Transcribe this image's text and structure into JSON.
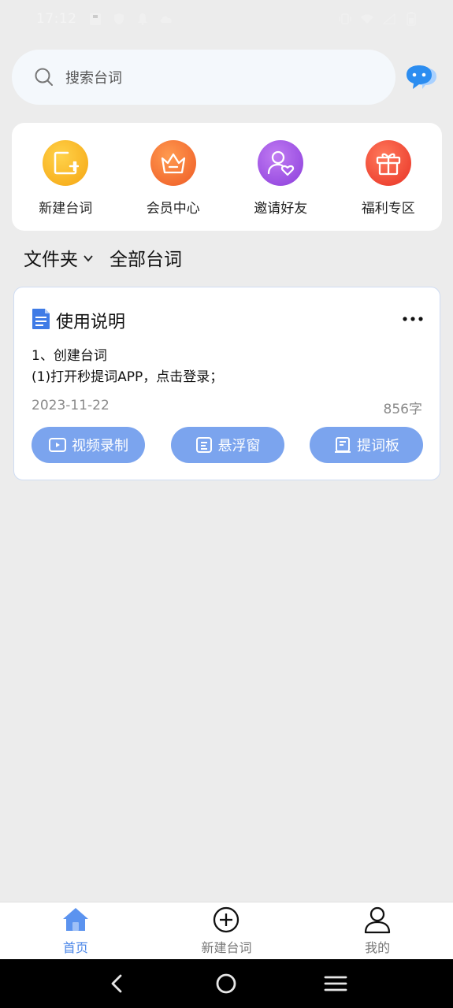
{
  "status_bar": {
    "time": "17:12"
  },
  "search": {
    "placeholder": "搜索台词"
  },
  "quick_menu": [
    {
      "label": "新建台词",
      "icon": "new-script-icon",
      "color": "#f7b21a"
    },
    {
      "label": "会员中心",
      "icon": "crown-icon",
      "color": "#f26a2a"
    },
    {
      "label": "邀请好友",
      "icon": "invite-friend-icon",
      "color": "#9c4fe0"
    },
    {
      "label": "福利专区",
      "icon": "gift-icon",
      "color": "#f0402e"
    }
  ],
  "filters": {
    "folder_label": "文件夹",
    "all_label": "全部台词"
  },
  "script_card": {
    "title": "使用说明",
    "line1": "1、创建台词",
    "line2": "(1)打开秒提词APP，点击登录；",
    "date": "2023-11-22",
    "word_count": "856字",
    "actions": [
      {
        "label": "视频录制",
        "icon": "video-record-icon"
      },
      {
        "label": "悬浮窗",
        "icon": "floating-window-icon"
      },
      {
        "label": "提词板",
        "icon": "prompter-board-icon"
      }
    ]
  },
  "bottom_nav": [
    {
      "label": "首页",
      "icon": "home-icon",
      "active": true
    },
    {
      "label": "新建台词",
      "icon": "add-circle-icon",
      "active": false
    },
    {
      "label": "我的",
      "icon": "profile-icon",
      "active": false
    }
  ],
  "colors": {
    "accent": "#4a86e8",
    "action_button": "#7ba4ee",
    "background": "#ececec"
  }
}
